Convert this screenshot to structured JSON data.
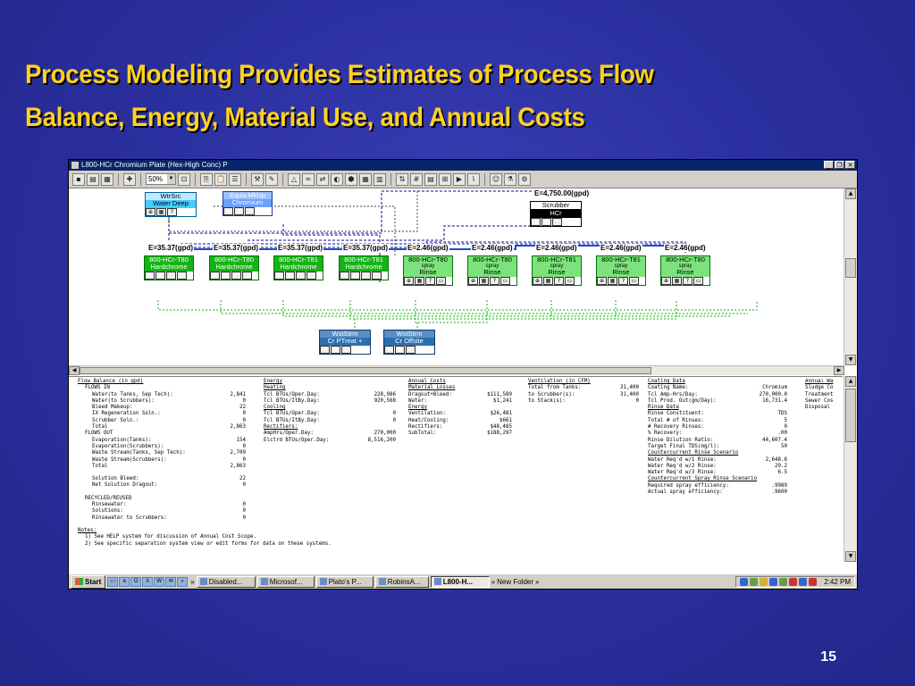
{
  "slide": {
    "title_line1": "Process Modeling Provides Estimates of  Process Flow",
    "title_line2": "Balance, Energy, Material Use, and Annual Costs",
    "page_number": "15"
  },
  "window": {
    "title": "L800-HCr Chromium Plate (Hex-High Conc)  P",
    "zoom": "50%"
  },
  "diagram": {
    "sources": [
      {
        "line1": "WtrSrc",
        "line2": "Water Deep"
      },
      {
        "line1": "Equiv.MkUp",
        "line2": "Chromium"
      }
    ],
    "scrubber": {
      "energy": "E=4,750.00(gpd)",
      "line1": "Scrubber",
      "line2": "HCr"
    },
    "tanks": [
      {
        "energy": "E=35.37(gpd)",
        "line1": "800-HCr-T80",
        "line2": "Hardchrome"
      },
      {
        "energy": "E=35.37(gpd)",
        "line1": "800-HCr-T80",
        "line2": "Hardchrome"
      },
      {
        "energy": "E=35.37(gpd)",
        "line1": "800-HCr-T81",
        "line2": "Hardchrome"
      },
      {
        "energy": "E=35.37(gpd)",
        "line1": "800-HCr-T81",
        "line2": "Hardchrome"
      },
      {
        "energy": "E=2.46(gpd)",
        "line1": "800-HCr-T80",
        "spray": "spray",
        "line2": "Rinse"
      },
      {
        "energy": "E=2.46(gpd)",
        "line1": "800-HCr-T80",
        "spray": "spray",
        "line2": "Rinse"
      },
      {
        "energy": "E=2.46(gpd)",
        "line1": "800-HCr-T81",
        "spray": "spray",
        "line2": "Rinse"
      },
      {
        "energy": "E=2.46(gpd)",
        "line1": "800-HCr-T81",
        "spray": "spray",
        "line2": "Rinse"
      },
      {
        "energy": "E=2.46(gpd)",
        "line1": "800-HCr-T80",
        "spray": "spray",
        "line2": "Rinse"
      }
    ],
    "wastes": [
      {
        "line1": "WstStrm",
        "line2": "Cr PTreat +"
      },
      {
        "line1": "WstStrm",
        "line2": "Cr Offsite"
      }
    ]
  },
  "report": {
    "flow": {
      "title": "Flow Balance (in gpd)",
      "in_title": "FLOWS IN",
      "in": [
        {
          "k": "Water(to Tanks, Sep Tech):",
          "v": "2,841"
        },
        {
          "k": "Water(to Scrubbers):",
          "v": "0"
        },
        {
          "k": "Bleed Makeup:",
          "v": "22"
        },
        {
          "k": "IX Regeneration Soln.:",
          "v": "0"
        },
        {
          "k": "Scrubber Soln.:",
          "v": "0"
        },
        {
          "k": "Total",
          "v": "2,863"
        }
      ],
      "out_title": "FLOWS OUT",
      "out": [
        {
          "k": "Evaporation(Tanks):",
          "v": "154"
        },
        {
          "k": "Evaporation(Scrubbers):",
          "v": "0"
        },
        {
          "k": "Waste Stream(Tanks, Sep Tech):",
          "v": "2,709"
        },
        {
          "k": "Waste Stream(Scrubbers):",
          "v": "0"
        },
        {
          "k": "Total",
          "v": "2,863"
        }
      ],
      "extra": [
        {
          "k": "Solution Bleed:",
          "v": "22"
        },
        {
          "k": "Net Solution Dragout:",
          "v": "0"
        }
      ],
      "recycled_title": "RECYCLED/REUSED",
      "recycled": [
        {
          "k": "Rinsewater:",
          "v": "0"
        },
        {
          "k": "Solutions:",
          "v": "0"
        },
        {
          "k": "Rinsewater to Scrubbers:",
          "v": "0"
        }
      ],
      "notes_title": "Notes:",
      "notes": [
        "1) See HELP system for discussion of Annual Cost Scope.",
        "2) See specific separation system view or edit forms for data on these systems."
      ]
    },
    "energy": {
      "title": "Energy",
      "heating_title": "Heating",
      "heating": [
        {
          "k": "Tcl BTUs/Oper.Day:",
          "v": "228,986"
        },
        {
          "k": "Tcl BTUs/ItBy.Day:",
          "v": "920,568"
        }
      ],
      "cooling_title": "Cooling",
      "cooling": [
        {
          "k": "Tcl BTUs/Oper.Day:",
          "v": "0"
        },
        {
          "k": "Tcl BTUs/ItBy.Day:",
          "v": "0"
        }
      ],
      "rectifiers_title": "Rectifiers:",
      "rectifiers": [
        {
          "k": "AmpHrs/Oper.Day:",
          "v": "270,000"
        },
        {
          "k": "Elctrd BTUs/Oper.Day:",
          "v": "8,516,200"
        }
      ]
    },
    "costs": {
      "title": "Annual Costs",
      "losses_title": "Material Losses",
      "losses": [
        {
          "k": "Dragout+Bleed:",
          "v": "$111,589"
        },
        {
          "k": "Water:",
          "v": "$1,241"
        }
      ],
      "energy_title": "Energy",
      "energy": [
        {
          "k": "Ventilation:",
          "v": "$26,481"
        },
        {
          "k": "Heat/Cooling:",
          "v": "$661"
        },
        {
          "k": "Rectifiers:",
          "v": "$48,485"
        },
        {
          "k": "SubTotal:",
          "v": "$188,297"
        }
      ]
    },
    "ventilation": {
      "title": "Ventilation (in CFM)",
      "rows": [
        {
          "k": "Total from Tanks:",
          "v": "31,400"
        },
        {
          "k": "to Scrubber(s):",
          "v": "31,400"
        },
        {
          "k": "to Stack(s):",
          "v": "0"
        }
      ]
    },
    "coating": {
      "title": "Coating Data",
      "rows": [
        {
          "k": "Coating Name:",
          "v": "Chromium"
        },
        {
          "k": "Tcl Amp-Hrs/Day:",
          "v": "270,000.0"
        },
        {
          "k": "Tcl Prod. Out(gm/Day):",
          "v": "16,731.4"
        }
      ],
      "rinse_title": "Rinse Data",
      "rinse": [
        {
          "k": "Rinse Constituent:",
          "v": "TDS"
        },
        {
          "k": "Total # of Rinses:",
          "v": "5"
        },
        {
          "k": "# Recovery Rinses:",
          "v": "0"
        },
        {
          "k": "% Recovery:",
          "v": ".00"
        },
        {
          "k": "Rinse Dilution Ratio:",
          "v": "44,607.4"
        },
        {
          "k": "Target Final TDS(mg/l):",
          "v": "50"
        }
      ],
      "scen1_title": "Countercurrent Rinse Scenario",
      "scen1": [
        {
          "k": "Water Req'd w/1 Rinse:",
          "v": "2,648.6"
        },
        {
          "k": "Water Req'd w/2 Rinse:",
          "v": "29.2"
        },
        {
          "k": "Water Req'd w/3 Rinse:",
          "v": "6.5"
        }
      ],
      "scen2_title": "Countercurrent Spray Rinse Scenario",
      "scen2": [
        {
          "k": "Required spray efficiency:",
          "v": ".9989"
        },
        {
          "k": "Actual spray efficiency:",
          "v": ".9600"
        }
      ]
    },
    "annual_waste": {
      "title": "Annual Wa",
      "rows": [
        "Sludge Co",
        "Treatment",
        "Sewer Cos",
        "Disposal"
      ]
    }
  },
  "taskbar": {
    "start": "Start",
    "tasks": [
      "Disabled...",
      "Microsof...",
      "Plato's P...",
      "RobinsA...",
      "L800-H..."
    ],
    "folder": "New Folder",
    "clock": "2:42 PM"
  }
}
